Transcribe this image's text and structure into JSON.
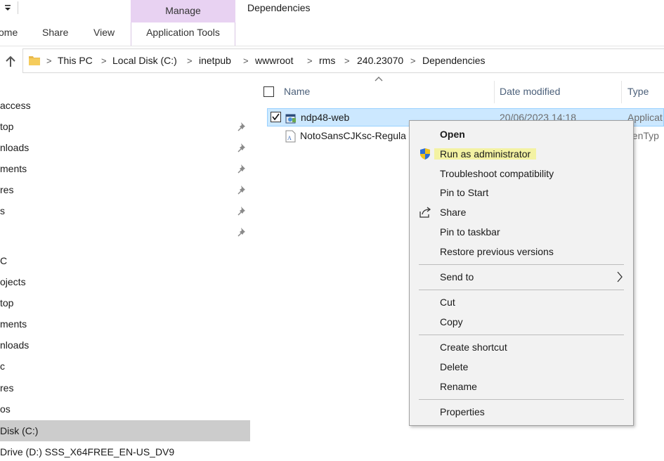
{
  "ribbon": {
    "manage_tab": "Manage",
    "folder_title": "Dependencies",
    "tabs": [
      "ome",
      "Share",
      "View"
    ],
    "application_tools": "Application Tools"
  },
  "address": {
    "breadcrumbs": [
      "This PC",
      "Local Disk (C:)",
      "inetpub",
      "wwwroot",
      "rms",
      "240.23070",
      "Dependencies"
    ]
  },
  "navpane": {
    "items": [
      {
        "label": "access",
        "pinned": false
      },
      {
        "label": "top",
        "pinned": true
      },
      {
        "label": "nloads",
        "pinned": true
      },
      {
        "label": "ments",
        "pinned": true
      },
      {
        "label": "res",
        "pinned": true
      },
      {
        "label": "s",
        "pinned": true
      },
      {
        "label": "",
        "pinned": true
      },
      {
        "label": "C",
        "pinned": false
      },
      {
        "label": "ojects",
        "pinned": false
      },
      {
        "label": "top",
        "pinned": false
      },
      {
        "label": "ments",
        "pinned": false
      },
      {
        "label": "nloads",
        "pinned": false
      },
      {
        "label": "c",
        "pinned": false
      },
      {
        "label": "res",
        "pinned": false
      },
      {
        "label": "os",
        "pinned": false
      },
      {
        "label": " Disk (C:)",
        "pinned": false,
        "selected": true
      },
      {
        "label": "Drive (D:) SSS_X64FREE_EN-US_DV9",
        "pinned": false
      }
    ]
  },
  "filelist": {
    "columns": {
      "name": "Name",
      "date": "Date modified",
      "type": "Type"
    },
    "files": [
      {
        "name": "ndp48-web",
        "date": "20/06/2023 14:18",
        "type": "Applicat",
        "selected": true,
        "checked": true,
        "icon": "installer-icon"
      },
      {
        "name": "NotoSansCJKsc-Regula",
        "date": "",
        "type": "penTyp",
        "selected": false,
        "checked": false,
        "icon": "font-file-icon"
      }
    ]
  },
  "context_menu": {
    "items": [
      {
        "label": "Open",
        "bold": true
      },
      {
        "label": "Run as administrator",
        "highlight": true,
        "icon": "uac-shield-icon"
      },
      {
        "label": "Troubleshoot compatibility"
      },
      {
        "label": "Pin to Start"
      },
      {
        "label": "Share",
        "icon": "share-icon"
      },
      {
        "label": "Pin to taskbar"
      },
      {
        "label": "Restore previous versions"
      },
      {
        "label": "Send to",
        "submenu": true
      },
      {
        "label": "Cut"
      },
      {
        "label": "Copy"
      },
      {
        "label": "Create shortcut"
      },
      {
        "label": "Delete"
      },
      {
        "label": "Rename"
      },
      {
        "label": "Properties"
      }
    ]
  },
  "colors": {
    "manage_tab_bg": "#e8d2f2",
    "selection_bg": "#cce8ff",
    "highlight": "#f3f2a3",
    "nav_selected": "#cccccc",
    "header_text": "#4c607a"
  }
}
